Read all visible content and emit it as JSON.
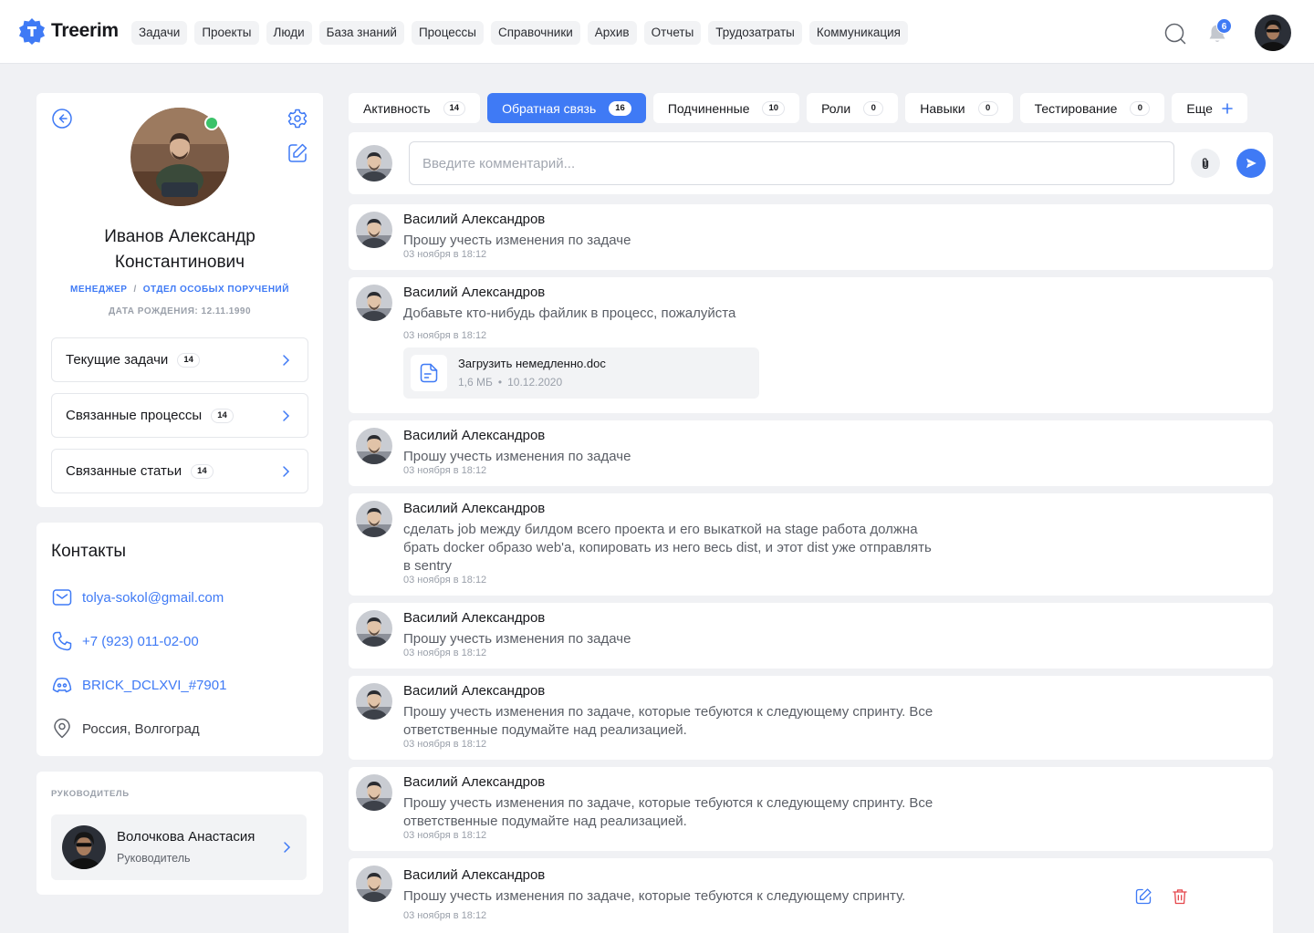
{
  "app": {
    "name": "Treerim",
    "notifications_count": "6"
  },
  "nav": [
    "Задачи",
    "Проекты",
    "Люди",
    "База знаний",
    "Процессы",
    "Справочники",
    "Архив",
    "Отчеты",
    "Трудозатраты",
    "Коммуникация"
  ],
  "profile": {
    "name_line1": "Иванов Александр",
    "name_line2": "Константинович",
    "role": "Менеджер",
    "department": "Отдел особых поручений",
    "role_separator": "/",
    "birthdate": "Дата рождения: 12.11.1990",
    "links": [
      {
        "label": "Текущие задачи",
        "count": "14"
      },
      {
        "label": "Связанные процессы",
        "count": "14"
      },
      {
        "label": "Связанные статьи",
        "count": "14"
      }
    ]
  },
  "contacts": {
    "title": "Контакты",
    "email": "tolya-sokol@gmail.com",
    "phone": "+7 (923) 011-02-00",
    "discord": "BRICK_DCLXVI_#7901",
    "location": "Россия, Волгоград"
  },
  "manager": {
    "label": "Руководитель",
    "name": "Волочкова Анастасия",
    "role": "Руководитель"
  },
  "tabs": [
    {
      "label": "Активность",
      "count": "14",
      "active": false
    },
    {
      "label": "Обратная связь",
      "count": "16",
      "active": true
    },
    {
      "label": "Подчиненные",
      "count": "10",
      "active": false
    },
    {
      "label": "Роли",
      "count": "0",
      "active": false
    },
    {
      "label": "Навыки",
      "count": "0",
      "active": false
    },
    {
      "label": "Тестирование",
      "count": "0",
      "active": false
    }
  ],
  "more_tab": "Еще",
  "composer": {
    "placeholder": "Введите комментарий...",
    "value": ""
  },
  "comments": [
    {
      "author": "Василий Александров",
      "text": "Прошу учесть изменения по задаче",
      "time": "03 ноября в 18:12"
    },
    {
      "author": "Василий Александров",
      "text": "Добавьте кто-нибудь файлик в процесс, пожалуйста",
      "time": "03 ноября в 18:12",
      "file": {
        "name": "Загрузить немедленно.doc",
        "size": "1,6 МБ",
        "date": "10.12.2020"
      }
    },
    {
      "author": "Василий Александров",
      "text": "Прошу учесть изменения по задаче",
      "time": "03 ноября в 18:12"
    },
    {
      "author": "Василий Александров",
      "text": "сделать job между билдом всего проекта и его выкаткой на stage работа должна брать docker образо web'a, копировать из него весь dist, и этот dist уже отправлять в sentry",
      "time": "03 ноября в 18:12"
    },
    {
      "author": "Василий Александров",
      "text": "Прошу учесть изменения по задаче",
      "time": "03 ноября в 18:12"
    },
    {
      "author": "Василий Александров",
      "text": "Прошу учесть изменения по задаче, которые тебуются к следующему спринту. Все ответственные подумайте над реализацией.",
      "time": "03 ноября в 18:12"
    },
    {
      "author": "Василий Александров",
      "text": "Прошу учесть изменения по задаче, которые тебуются к следующему спринту. Все ответственные подумайте над реализацией.",
      "time": "03 ноября в 18:12"
    },
    {
      "author": "Василий Александров",
      "text": "Прошу учесть изменения по задаче, которые тебуются к следующему спринту.",
      "time": "03 ноября в 18:12"
    }
  ],
  "colors": {
    "accent": "#3f7af5",
    "online": "#3cc26a",
    "delete": "#e5484d"
  },
  "icons": [
    "search-icon",
    "bell-icon",
    "back-arrow-icon",
    "gear-icon",
    "edit-icon",
    "chevron-right-icon",
    "mail-icon",
    "phone-icon",
    "discord-icon",
    "location-pin-icon",
    "plus-icon",
    "paperclip-icon",
    "send-icon",
    "file-icon",
    "trash-icon"
  ]
}
